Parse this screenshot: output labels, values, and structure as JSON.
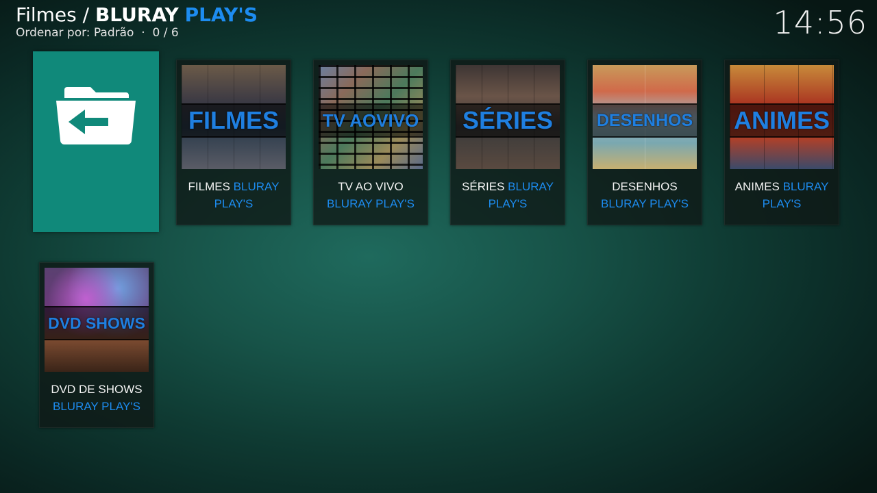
{
  "header": {
    "crumb_prefix": "Filmes /",
    "crumb_bold": "BLURAY",
    "crumb_accent": "PLAY'S",
    "sort_label": "Ordenar por: Padrão",
    "sort_separator": "·",
    "count": "0 / 6",
    "clock": "14:56"
  },
  "colors": {
    "accent": "#1d8cf0",
    "back_tile": "#10897a"
  },
  "back_tile": {
    "icon": "folder-back-icon"
  },
  "items": [
    {
      "thumb_text": "FILMES",
      "line1_white": "FILMES ",
      "line1_blue": "BLURAY",
      "line2_white": "",
      "line2_blue": "PLAY'S"
    },
    {
      "thumb_text": "TV AOVIVO",
      "line1_white": "TV AO VIVO",
      "line1_blue": "",
      "line2_white": "",
      "line2_blue": "BLURAY PLAY'S"
    },
    {
      "thumb_text": "SÉRIES",
      "line1_white": "SÉRIES ",
      "line1_blue": "BLURAY",
      "line2_white": "",
      "line2_blue": "PLAY'S"
    },
    {
      "thumb_text": "DESENHOS",
      "line1_white": "DESENHOS",
      "line1_blue": "",
      "line2_white": "",
      "line2_blue": "BLURAY PLAY'S"
    },
    {
      "thumb_text": "ANIMES",
      "line1_white": "ANIMES ",
      "line1_blue": "BLURAY",
      "line2_white": "",
      "line2_blue": "PLAY'S"
    },
    {
      "thumb_text": "DVD SHOWS",
      "line1_white": "DVD DE SHOWS",
      "line1_blue": "",
      "line2_white": "",
      "line2_blue": "BLURAY PLAY'S"
    }
  ]
}
